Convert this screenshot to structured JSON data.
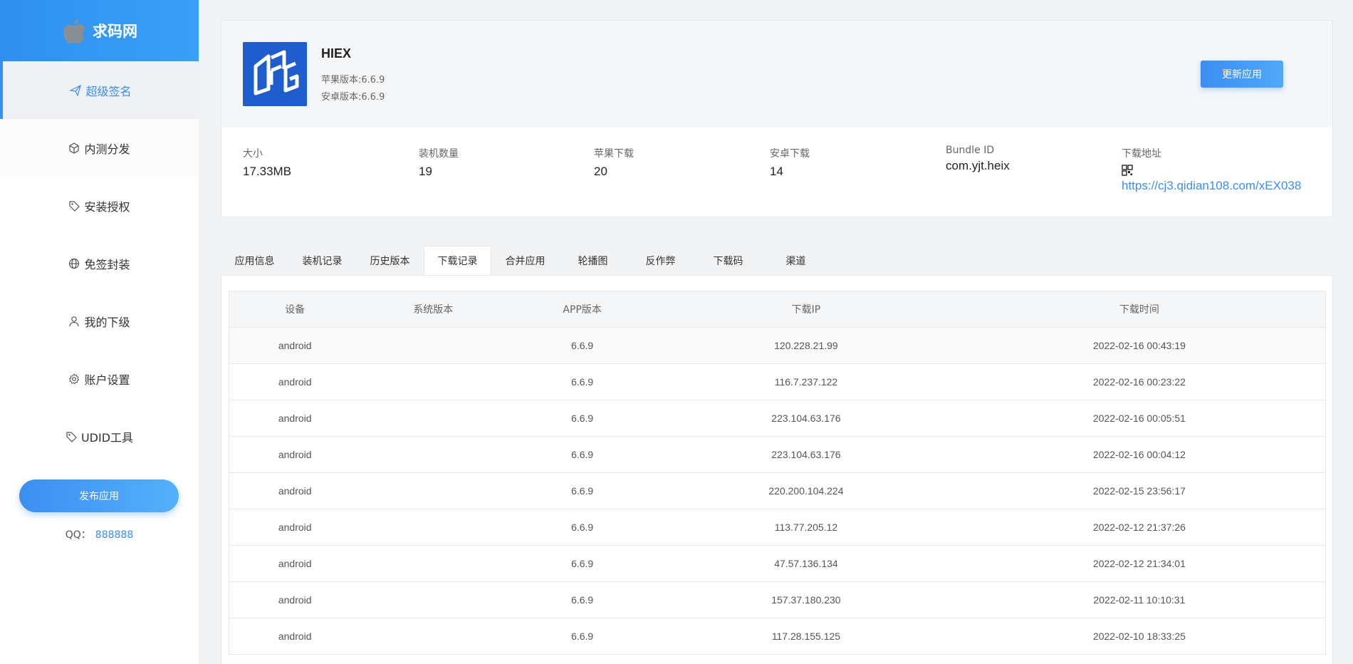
{
  "brand": {
    "name": "求码网",
    "logo_icon": "apple-icon",
    "color": "#3b8ff2"
  },
  "sidebar": {
    "items": [
      {
        "label": "超级签名",
        "icon": "send-icon",
        "active": true
      },
      {
        "label": "内测分发",
        "icon": "cube-icon"
      },
      {
        "label": "安装授权",
        "icon": "tag-icon"
      },
      {
        "label": "免签封装",
        "icon": "globe-icon"
      },
      {
        "label": "我的下级",
        "icon": "user-icon"
      },
      {
        "label": "账户设置",
        "icon": "gear-icon"
      },
      {
        "label": "UDID工具",
        "icon": "tag-icon"
      }
    ],
    "publish_label": "发布应用",
    "qq_label": "QQ：",
    "qq_value": "888888"
  },
  "app": {
    "name": "HIEX",
    "ios_version": "苹果版本:6.6.9",
    "android_version": "安卓版本:6.6.9",
    "update_label": "更新应用",
    "stats": [
      {
        "label": "大小",
        "value": "17.33MB"
      },
      {
        "label": "装机数量",
        "value": "19"
      },
      {
        "label": "苹果下载",
        "value": "20"
      },
      {
        "label": "安卓下载",
        "value": "14"
      },
      {
        "label": "Bundle ID",
        "value": "com.yjt.heix"
      }
    ],
    "download_label": "下载地址",
    "download_url": "https://cj3.qidian108.com/xEX038"
  },
  "tabs": [
    "应用信息",
    "装机记录",
    "历史版本",
    "下载记录",
    "合并应用",
    "轮播图",
    "反作弊",
    "下载码",
    "渠道"
  ],
  "active_tab": 3,
  "table": {
    "headers": [
      "设备",
      "系统版本",
      "APP版本",
      "下载IP",
      "下载时间"
    ],
    "rows": [
      [
        "android",
        "",
        "6.6.9",
        "120.228.21.99",
        "2022-02-16 00:43:19"
      ],
      [
        "android",
        "",
        "6.6.9",
        "116.7.237.122",
        "2022-02-16 00:23:22"
      ],
      [
        "android",
        "",
        "6.6.9",
        "223.104.63.176",
        "2022-02-16 00:05:51"
      ],
      [
        "android",
        "",
        "6.6.9",
        "223.104.63.176",
        "2022-02-16 00:04:12"
      ],
      [
        "android",
        "",
        "6.6.9",
        "220.200.104.224",
        "2022-02-15 23:56:17"
      ],
      [
        "android",
        "",
        "6.6.9",
        "113.77.205.12",
        "2022-02-12 21:37:26"
      ],
      [
        "android",
        "",
        "6.6.9",
        "47.57.136.134",
        "2022-02-12 21:34:01"
      ],
      [
        "android",
        "",
        "6.6.9",
        "157.37.180.230",
        "2022-02-11 10:10:31"
      ],
      [
        "android",
        "",
        "6.6.9",
        "117.28.155.125",
        "2022-02-10 18:33:25"
      ]
    ]
  }
}
